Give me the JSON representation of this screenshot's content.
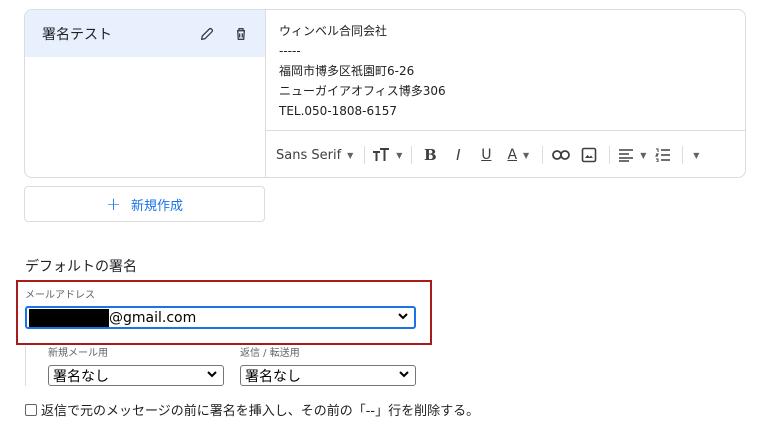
{
  "signature_list": {
    "items": [
      {
        "name": "署名テスト"
      }
    ]
  },
  "signature_body": {
    "lines": [
      "ウィンベル合同会社",
      "-----",
      "福岡市博多区祇園町6-26",
      "ニューガイアオフィス博多306",
      "TEL.050-1808-6157"
    ]
  },
  "toolbar": {
    "font": "Sans Serif",
    "bold": "B",
    "italic": "I",
    "underline": "U",
    "text_color": "A"
  },
  "new_button": {
    "plus": "+",
    "label": "新規作成"
  },
  "default_signature": {
    "title": "デフォルトの署名",
    "email_label": "メールアドレス",
    "email_value": "@gmail.com",
    "new_mail_label": "新規メール用",
    "new_mail_value": "署名なし",
    "reply_label": "返信 / 転送用",
    "reply_value": "署名なし"
  },
  "checkbox": {
    "label": "返信で元のメッセージの前に署名を挿入し、その前の「--」行を削除する。"
  },
  "colors": {
    "accent": "#1a73e8",
    "selected_bg": "#e8f0fe",
    "highlight_border": "#a61c1c"
  }
}
